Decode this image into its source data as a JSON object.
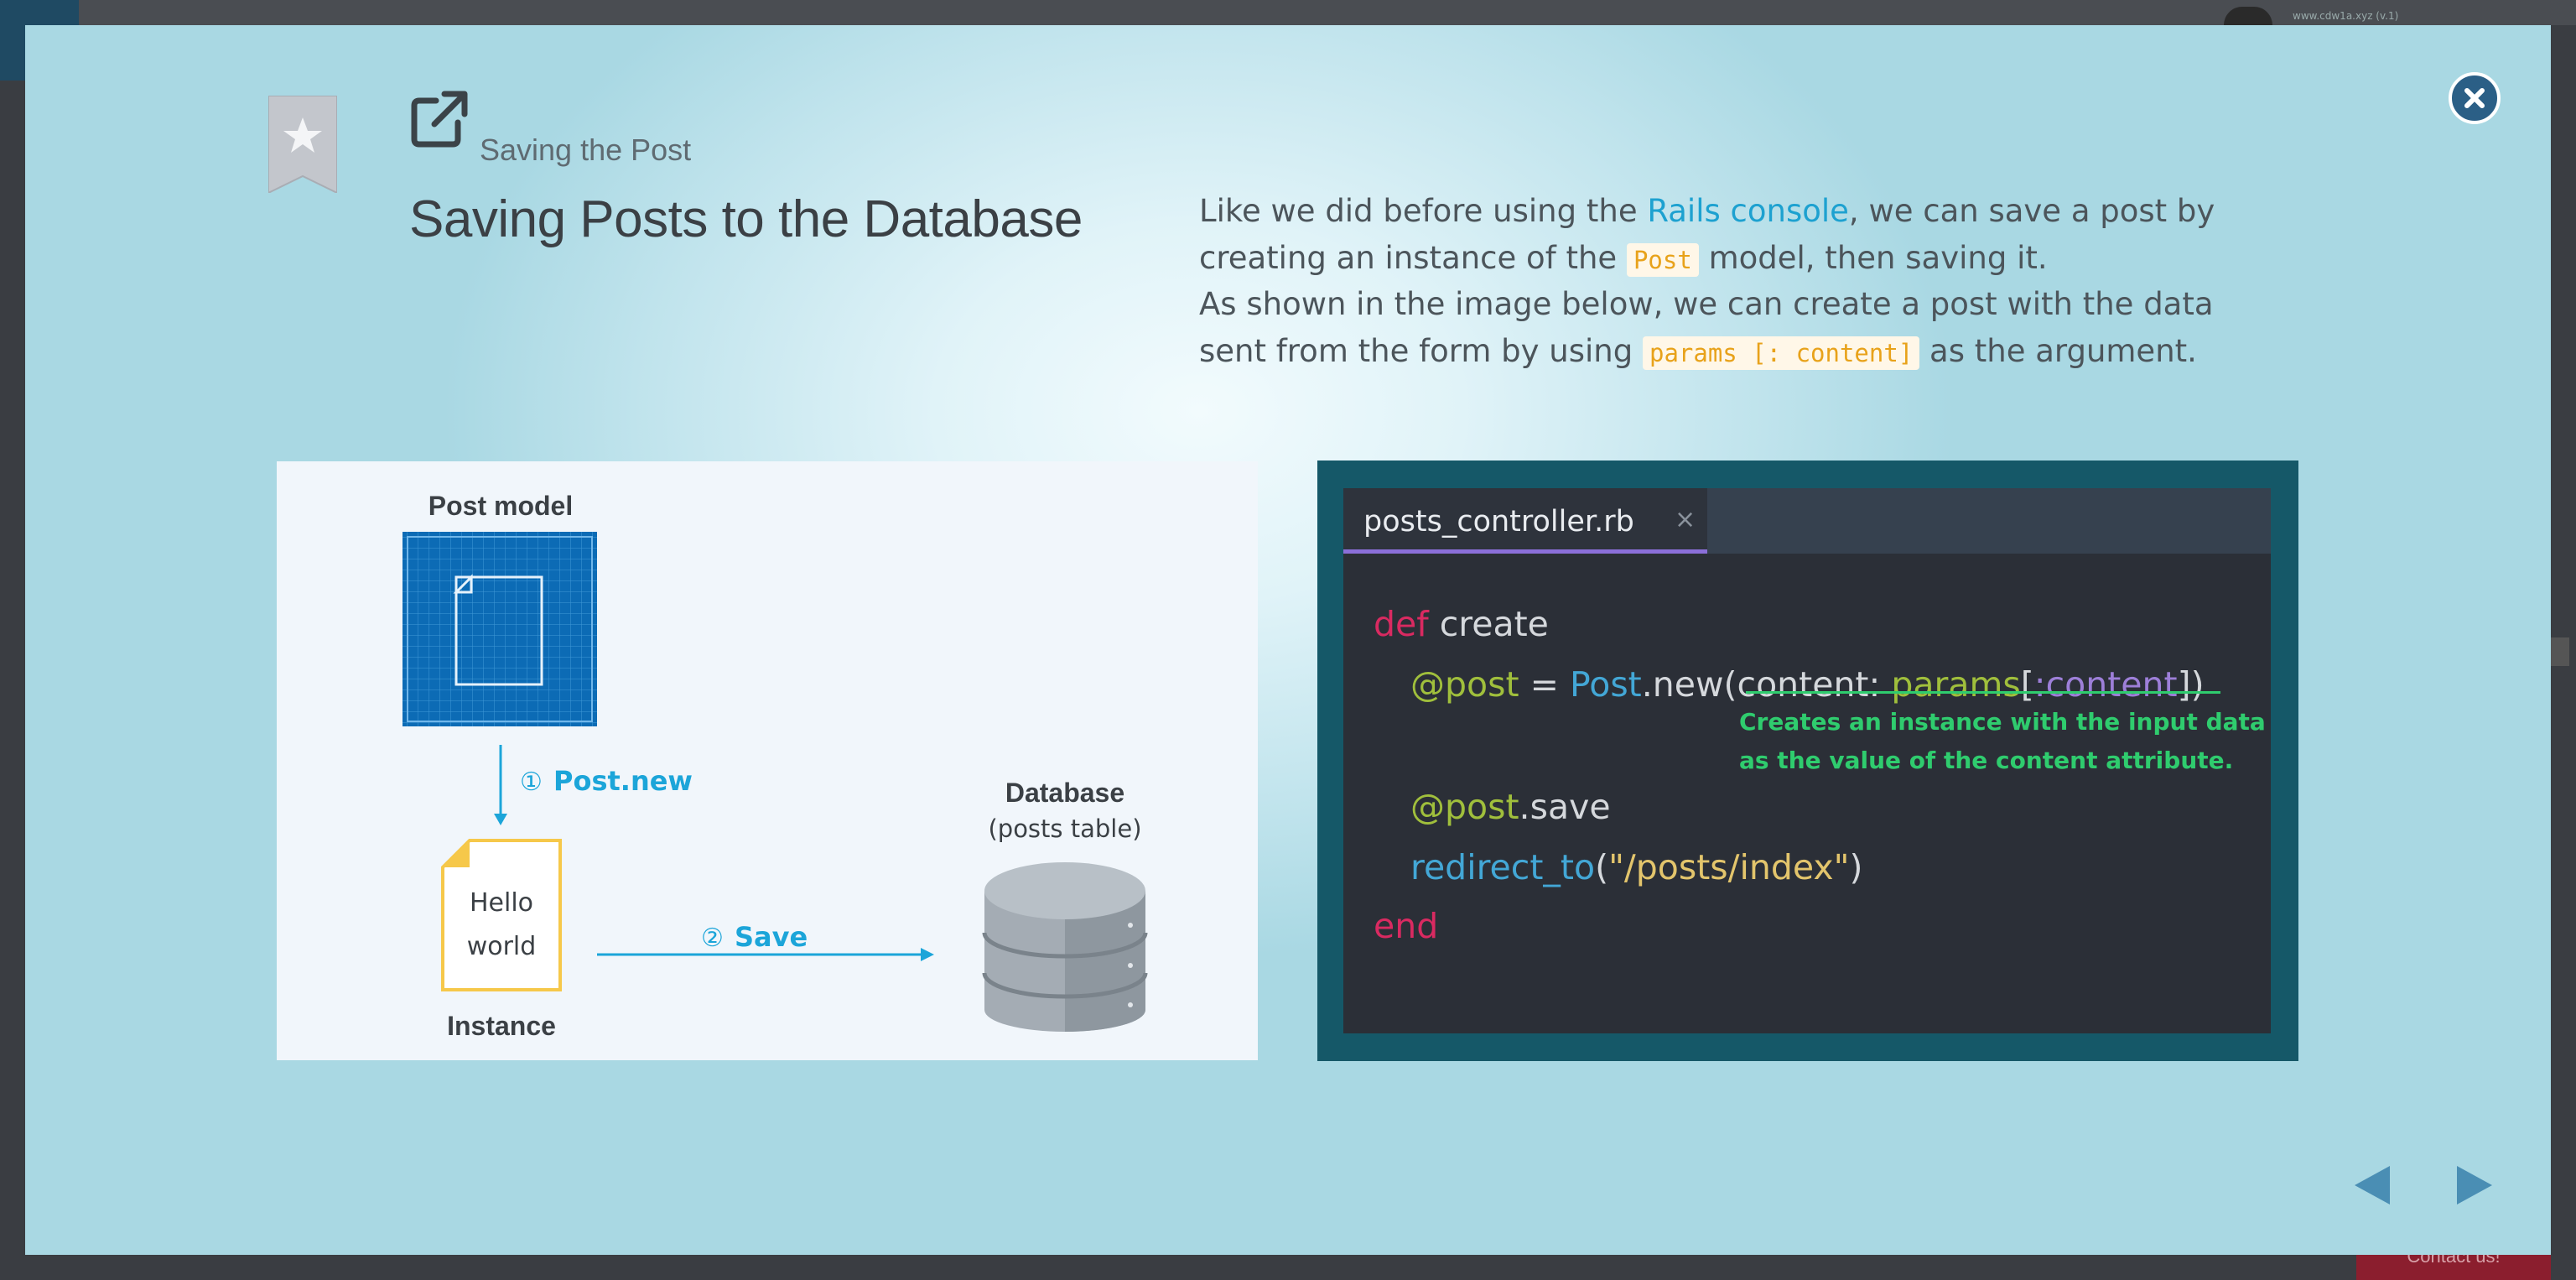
{
  "background": {
    "url_hint": "www.cdw1a.xyz (v.1)",
    "contact_button": "Contact us!"
  },
  "modal": {
    "section_label": "Saving the Post",
    "title": "Saving Posts to the Database",
    "description": {
      "p1_a": "Like we did before using the ",
      "p1_link": "Rails console",
      "p1_b": ", we can save a post by creating an instance of the ",
      "p1_code": "Post",
      "p1_c": " model, then saving it.",
      "p2_a": "As shown in the image below, we can create a post with the data sent from the form by using ",
      "p2_code": "params [: content]",
      "p2_b": " as the argument."
    },
    "icons": {
      "bookmark": "bookmark-star-icon",
      "external": "external-link-icon",
      "close": "close-icon",
      "prev": "arrow-left-icon",
      "next": "arrow-right-icon"
    }
  },
  "diagram": {
    "post_model_label": "Post model",
    "step1_num": "①",
    "step1_label": "Post.new",
    "doc_line1": "Hello",
    "doc_line2": "world",
    "instance_label": "Instance",
    "step2_num": "②",
    "step2_label": "Save",
    "db_label": "Database",
    "db_sublabel": "(posts table)"
  },
  "code_panel": {
    "tab_name": "posts_controller.rb",
    "tab_close": "×",
    "line1_kw": "def",
    "line1_rest": " create",
    "line2_ivar": "@post",
    "line2_eq": " = ",
    "line2_cls": "Post",
    "line2_call": ".new(content: ",
    "line2_params": "params",
    "line2_br1": "[",
    "line2_sym": ":content",
    "line2_br2": "])",
    "note_line1": "Creates an instance with the input data",
    "note_line2": "as the value of the content attribute.",
    "line3_ivar": "@post",
    "line3_rest": ".save",
    "line4_fn": "redirect_to",
    "line4_p1": "(",
    "line4_str": "\"/posts/index\"",
    "line4_p2": ")",
    "line5_kw": "end"
  },
  "colors": {
    "accent_link": "#1da1d0",
    "code_bg": "#2b2f37",
    "frame": "#155868",
    "keyword": "#d92a61",
    "note": "#2fcc6e"
  }
}
